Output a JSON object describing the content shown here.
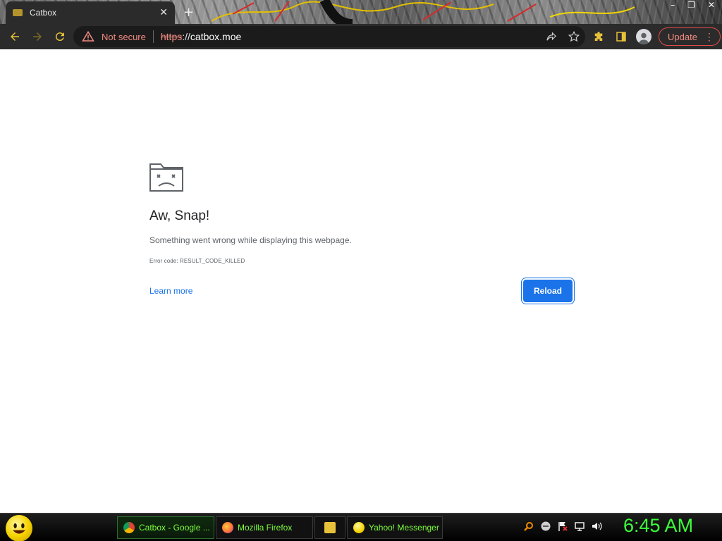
{
  "browser": {
    "tab": {
      "title": "Catbox",
      "close_glyph": "✕"
    },
    "new_tab_glyph": "+",
    "window_controls": [
      "–",
      "❐",
      "✕"
    ],
    "omnibox": {
      "security_label": "Not secure",
      "url_scheme": "https",
      "url_separator": "://",
      "url_host": "catbox.moe"
    },
    "update_label": "Update",
    "menu_glyph": "⋮",
    "accent_color": "#f28b82"
  },
  "error_page": {
    "title": "Aw, Snap!",
    "message": "Something went wrong while displaying this webpage.",
    "error_code": "Error code: RESULT_CODE_KILLED",
    "learn_more": "Learn more",
    "reload": "Reload",
    "button_color": "#1a73e8"
  },
  "taskbar": {
    "tasks": [
      {
        "label": "Catbox - Google ...",
        "icon": "chrome-icon",
        "active": true
      },
      {
        "label": "Mozilla Firefox",
        "icon": "firefox-icon",
        "active": false
      },
      {
        "label": "",
        "icon": "folder-icon",
        "active": false
      },
      {
        "label": "Yahoo! Messenger",
        "icon": "yahoo-messenger-icon",
        "active": false
      }
    ],
    "clock": "6:45 AM",
    "clock_color": "#3cff3c"
  }
}
